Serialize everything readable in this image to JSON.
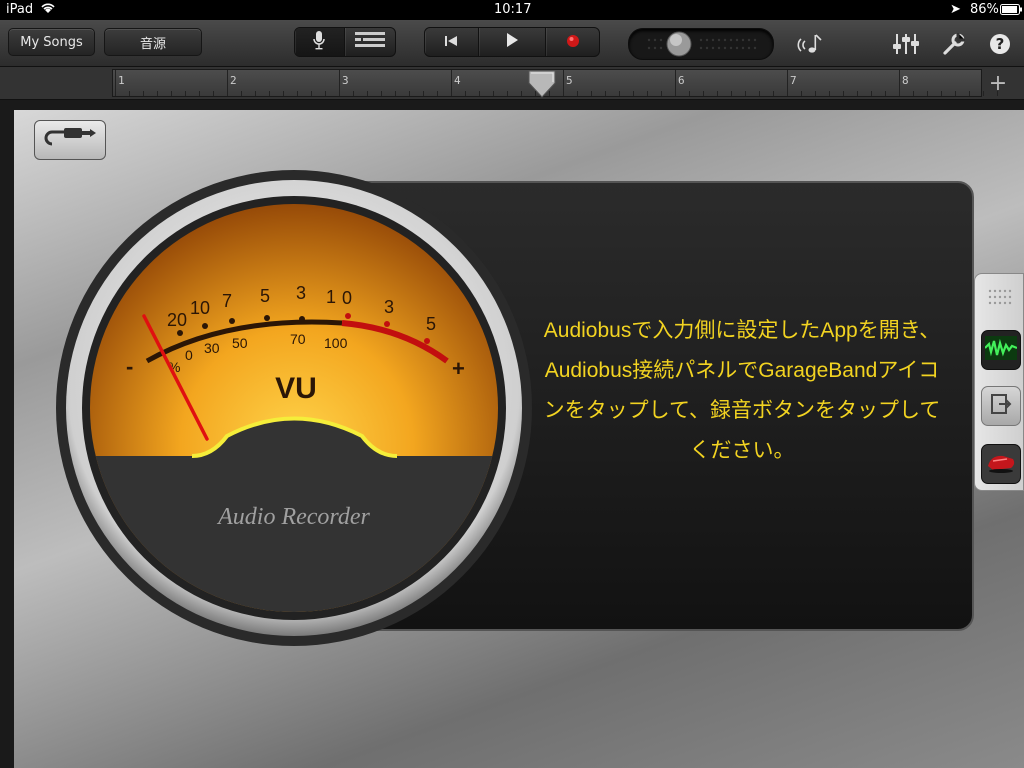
{
  "status": {
    "device": "iPad",
    "time": "10:17",
    "battery": "86%"
  },
  "toolbar": {
    "my_songs": "My Songs",
    "sound": "音源",
    "icons": [
      "mic-icon",
      "tracks-view-icon",
      "rewind-icon",
      "play-icon",
      "record-icon",
      "volume-slider",
      "metronome-icon",
      "mixer-icon",
      "settings-wrench-icon",
      "help-icon"
    ]
  },
  "ruler": {
    "numbers": [
      "1",
      "2",
      "3",
      "4",
      "5",
      "6",
      "7",
      "8"
    ],
    "add": "+"
  },
  "meter": {
    "vu": "VU",
    "brand": "Audio Recorder",
    "scale_top": [
      "20",
      "10",
      "7",
      "5",
      "3",
      "1",
      "0",
      "3",
      "5"
    ],
    "scale_bottom": [
      "%",
      "0",
      "30",
      "50",
      "70",
      "100"
    ],
    "minus": "-",
    "plus": "+"
  },
  "message": "Audiobusで入力側に設定したAppを開き、Audiobus接続パネルでGarageBandアイコンをタップして、録音ボタンをタップしてください。",
  "audiobus_panel": {
    "items": [
      "grip-icon",
      "audiobus-input-icon",
      "audiobus-connect-icon",
      "garageband-app-icon"
    ]
  },
  "colors": {
    "accent_text": "#f2d321",
    "record": "#d01818",
    "meter_face": "#f0a020"
  }
}
